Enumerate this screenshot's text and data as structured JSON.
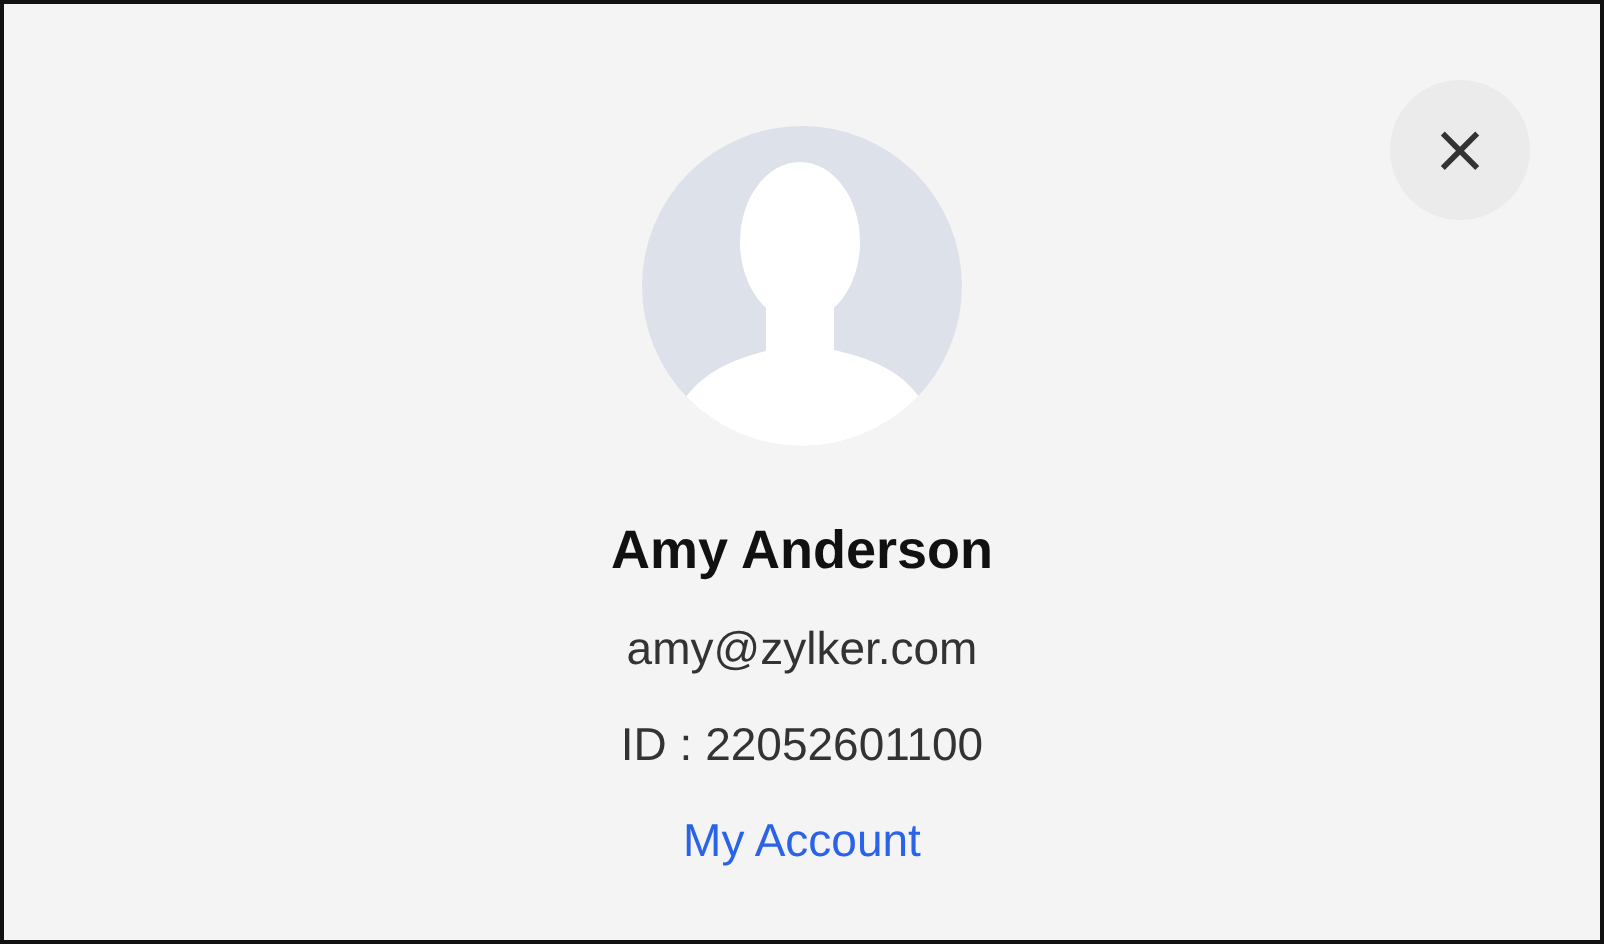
{
  "profile": {
    "name": "Amy Anderson",
    "email": "amy@zylker.com",
    "id_label": "ID : 22052601100",
    "account_link": "My Account"
  },
  "close_button": {
    "label": "×"
  }
}
